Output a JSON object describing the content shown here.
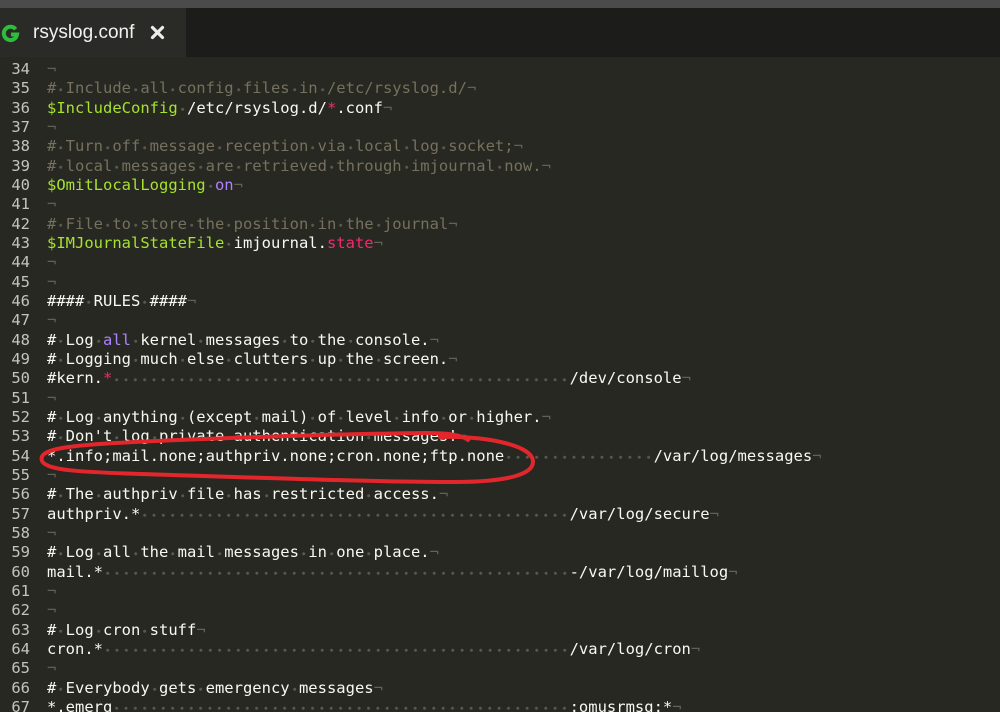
{
  "tab": {
    "title": "rsyslog.conf",
    "icon": "green-g-file-icon",
    "close_icon": "close-icon"
  },
  "theme": {
    "background": "#272822",
    "tab_bar": "#1c1c1a",
    "tab_active": "#2a2b26",
    "top_strip": "#4b4b4b",
    "default_text": "#f8f8f2",
    "line_number": "#c4c4bc",
    "whitespace_marker": "#58594e",
    "eol_marker": "#606157"
  },
  "editor": {
    "eol_marker": "¬",
    "lines": [
      {
        "n": "34",
        "tokens": []
      },
      {
        "n": "35",
        "tokens": [
          {
            "t": "# Include all config files in /etc/rsyslog.d/",
            "c": "#75715e"
          }
        ]
      },
      {
        "n": "36",
        "tokens": [
          {
            "t": "$IncludeConfig",
            "c": "#a6e22e"
          },
          {
            "t": " /etc/rsyslog.d/"
          },
          {
            "t": "*",
            "c": "#f92672"
          },
          {
            "t": ".conf"
          }
        ]
      },
      {
        "n": "37",
        "tokens": []
      },
      {
        "n": "38",
        "tokens": [
          {
            "t": "# Turn off message reception via local log socket;",
            "c": "#75715e"
          }
        ]
      },
      {
        "n": "39",
        "tokens": [
          {
            "t": "# local messages are retrieved through imjournal now.",
            "c": "#75715e"
          }
        ]
      },
      {
        "n": "40",
        "tokens": [
          {
            "t": "$OmitLocalLogging",
            "c": "#a6e22e"
          },
          {
            "t": " on",
            "c": "#ae81ff"
          }
        ]
      },
      {
        "n": "41",
        "tokens": []
      },
      {
        "n": "42",
        "tokens": [
          {
            "t": "# File to store the position in the journal",
            "c": "#75715e"
          }
        ]
      },
      {
        "n": "43",
        "tokens": [
          {
            "t": "$IMJournalStateFile",
            "c": "#a6e22e"
          },
          {
            "t": " imjournal."
          },
          {
            "t": "state",
            "c": "#f92672"
          }
        ]
      },
      {
        "n": "44",
        "tokens": []
      },
      {
        "n": "45",
        "tokens": []
      },
      {
        "n": "46",
        "tokens": [
          {
            "t": "#### RULES ####"
          }
        ]
      },
      {
        "n": "47",
        "tokens": []
      },
      {
        "n": "48",
        "tokens": [
          {
            "t": "# Log "
          },
          {
            "t": "all",
            "c": "#ae81ff"
          },
          {
            "t": " kernel messages to the console."
          }
        ]
      },
      {
        "n": "49",
        "tokens": [
          {
            "t": "# Logging much else clutters up the screen."
          }
        ]
      },
      {
        "n": "50",
        "tokens": [
          {
            "t": "#kern."
          },
          {
            "t": "*",
            "c": "#f92672"
          },
          {
            "t": "                                                 /dev/console"
          }
        ]
      },
      {
        "n": "51",
        "tokens": []
      },
      {
        "n": "52",
        "tokens": [
          {
            "t": "# Log anything (except mail) of level info or higher."
          }
        ]
      },
      {
        "n": "53",
        "tokens": [
          {
            "t": "# Don't log private authentication messages!"
          }
        ]
      },
      {
        "n": "54",
        "tokens": [
          {
            "t": "*.info;mail.none;authpriv.none;cron.none;ftp.none                /var/log/messages"
          }
        ]
      },
      {
        "n": "55",
        "tokens": []
      },
      {
        "n": "56",
        "tokens": [
          {
            "t": "# The authpriv file has restricted access."
          }
        ]
      },
      {
        "n": "57",
        "tokens": [
          {
            "t": "authpriv.*                                              /var/log/secure"
          }
        ]
      },
      {
        "n": "58",
        "tokens": []
      },
      {
        "n": "59",
        "tokens": [
          {
            "t": "# Log all the mail messages in one place."
          }
        ]
      },
      {
        "n": "60",
        "tokens": [
          {
            "t": "mail.*                                                  -/var/log/maillog"
          }
        ]
      },
      {
        "n": "61",
        "tokens": []
      },
      {
        "n": "62",
        "tokens": []
      },
      {
        "n": "63",
        "tokens": [
          {
            "t": "# Log cron stuff"
          }
        ]
      },
      {
        "n": "64",
        "tokens": [
          {
            "t": "cron.*                                                  /var/log/cron"
          }
        ]
      },
      {
        "n": "65",
        "tokens": []
      },
      {
        "n": "66",
        "tokens": [
          {
            "t": "# Everybody gets emergency messages"
          }
        ]
      },
      {
        "n": "67",
        "tokens": [
          {
            "t": "*.emerg                                                 :omusrmsg:*"
          }
        ]
      }
    ]
  },
  "annotation": {
    "icon": "red-hand-drawn-ellipse",
    "color": "#e2262c"
  }
}
